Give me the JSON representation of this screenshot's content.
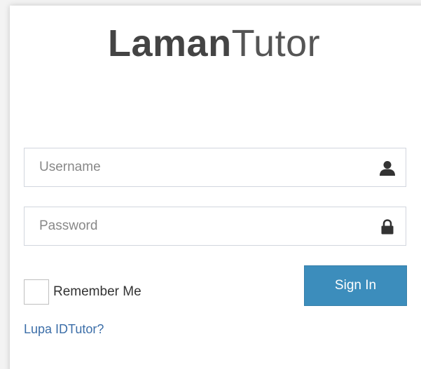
{
  "logo": {
    "bold": "Laman",
    "light": "Tutor"
  },
  "form": {
    "username_placeholder": "Username",
    "password_placeholder": "Password",
    "remember_label": "Remember Me",
    "signin_label": "Sign In",
    "forgot_link": "Lupa IDTutor?"
  },
  "icons": {
    "username": "user-icon",
    "password": "lock-icon"
  },
  "colors": {
    "primary": "#3c8dbc",
    "link": "#3c6ea8",
    "text": "#444444"
  }
}
